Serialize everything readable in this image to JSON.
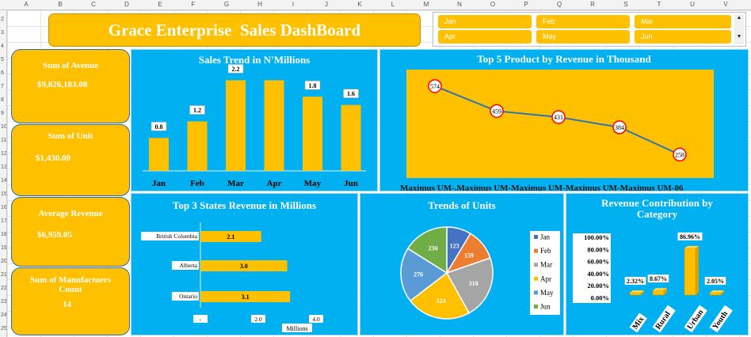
{
  "sheet": {
    "columns": [
      "A",
      "B",
      "C",
      "D",
      "E",
      "F",
      "G",
      "H",
      "I",
      "J",
      "K",
      "L",
      "M",
      "N",
      "O",
      "P",
      "Q",
      "R",
      "S",
      "T",
      "U",
      "V"
    ],
    "rows": [
      "2",
      "3",
      "4",
      "5",
      "6",
      "7",
      "8",
      "9",
      "10",
      "11",
      "12",
      "13",
      "14",
      "15",
      "16",
      "17",
      "18",
      "19",
      "20",
      "21",
      "22",
      "23",
      "24",
      "25"
    ]
  },
  "dashboard": {
    "title": "Grace Enterprise  Sales DashBoard"
  },
  "slicer": {
    "items": [
      "Jan",
      "Feb",
      "Mar",
      "Apr",
      "May",
      "Jun"
    ],
    "scroll_up": "▲",
    "scroll_down": "▼"
  },
  "kpis": [
    {
      "label": "Sum of Avenue",
      "value": "$9,826,183.08"
    },
    {
      "label": "Sum of Unit",
      "value": "$1,430.00"
    },
    {
      "label": "Average  Revenue",
      "value": "$6,959.05"
    },
    {
      "label": "Sum of Manufactuers Count",
      "value": "14"
    }
  ],
  "colors": {
    "panel": "#00b0f0",
    "gold": "#ffc000",
    "line": "#2e75b6",
    "marker": "#ff0000"
  },
  "chart_data": [
    {
      "type": "bar",
      "title": "Sales Trend in N'Millions",
      "categories": [
        "Jan",
        "Feb",
        "Mar",
        "Apr",
        "May",
        "Jun"
      ],
      "values": [
        0.8,
        1.2,
        2.2,
        2.2,
        1.8,
        1.6
      ],
      "data_labels": [
        "0.8",
        "1.2",
        "2.2",
        "",
        "1.8",
        "1.6"
      ],
      "ylim": [
        0,
        2.4
      ]
    },
    {
      "type": "line",
      "title": "Top 5 Product  by Revenue in Thousand",
      "categories": [
        "Maximus UM-",
        "Maximus UM-",
        "Maximus UM-",
        "Maximus UM-",
        "Maximus UM-06"
      ],
      "axis_text": "Maximus UM-.Maximus UM-Maximus UM-Maximus UM-Maximus UM-06",
      "values": [
        574,
        459,
        431,
        384,
        258
      ],
      "ylim": [
        150,
        650
      ]
    },
    {
      "type": "bar",
      "orientation": "horizontal",
      "title": "Top 3 States  Revenue  in Millions",
      "categories": [
        "British Columbia",
        "Alberta",
        "Ontario"
      ],
      "values": [
        2.1,
        3.0,
        3.1
      ],
      "data_labels": [
        "2.1",
        "3.0",
        "3.1"
      ],
      "x_ticks": [
        "-",
        "2.0",
        "4.0"
      ],
      "xlim": [
        0,
        4
      ],
      "xlabel": "Millions"
    },
    {
      "type": "pie",
      "title": "Trends  of Units",
      "categories": [
        "Jan",
        "Feb",
        "Mar",
        "Apr",
        "May",
        "Jun"
      ],
      "values": [
        123,
        159,
        318,
        324,
        276,
        230
      ],
      "colors": [
        "#4472c4",
        "#ed7d31",
        "#a5a5a5",
        "#ffc000",
        "#5b9bd5",
        "#70ad47"
      ]
    },
    {
      "type": "bar",
      "title": "Revenue Contribution by Category",
      "categories": [
        "Mix",
        "Rural",
        "Urban",
        "Youth"
      ],
      "values": [
        2.32,
        8.67,
        86.96,
        2.05
      ],
      "data_labels": [
        "2.32%",
        "8.67%",
        "86.96%",
        "2.05%"
      ],
      "y_ticks": [
        "100.00%",
        "80.00%",
        "60.00%",
        "40.00%",
        "20.00%",
        "0.00%"
      ],
      "ylim": [
        0,
        100
      ]
    }
  ]
}
